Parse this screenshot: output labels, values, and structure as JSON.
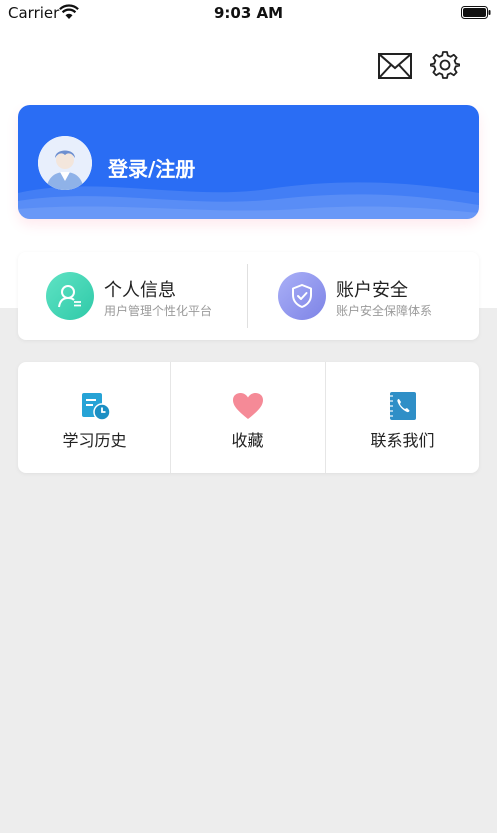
{
  "status_bar": {
    "carrier": "Carrier",
    "time": "9:03 AM"
  },
  "header": {
    "mail_icon": "envelope-icon",
    "settings_icon": "gear-icon"
  },
  "login_card": {
    "label": "登录/注册",
    "avatar_icon": "user-avatar-icon",
    "color": "#2a6df4"
  },
  "info_items": [
    {
      "title": "个人信息",
      "subtitle": "用户管理个性化平台",
      "icon": "user-profile-icon",
      "color": "#3dd6b3"
    },
    {
      "title": "账户安全",
      "subtitle": "账户安全保障体系",
      "icon": "shield-check-icon",
      "color": "#8a8ff0"
    }
  ],
  "grid_items": [
    {
      "label": "学习历史",
      "icon": "history-clock-icon",
      "color": "#26a3d6"
    },
    {
      "label": "收藏",
      "icon": "heart-icon",
      "color": "#f58a97"
    },
    {
      "label": "联系我们",
      "icon": "phone-contact-icon",
      "color": "#2f8fc7"
    }
  ]
}
